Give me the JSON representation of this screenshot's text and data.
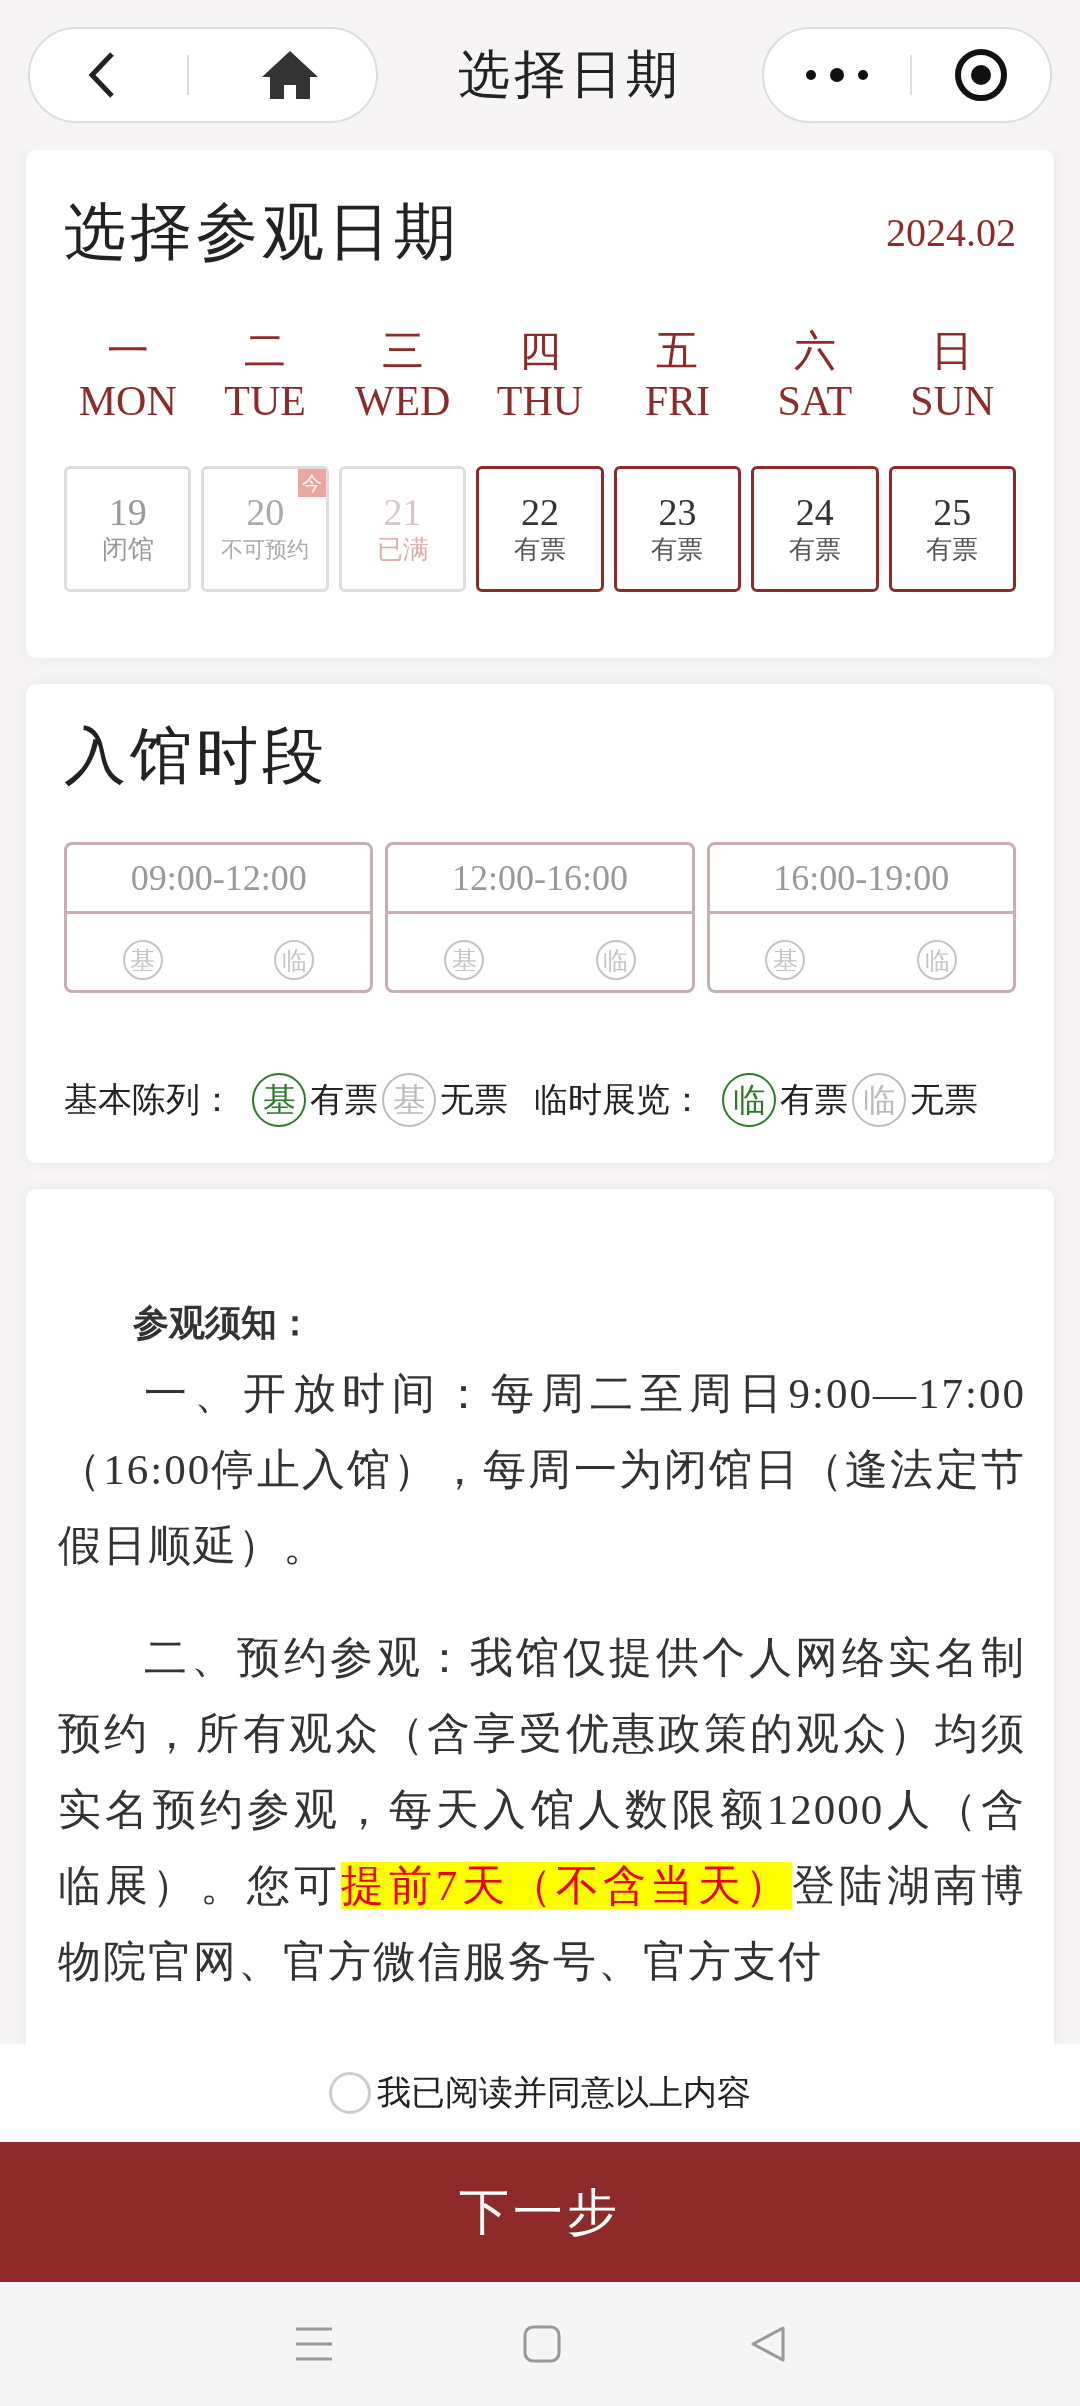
{
  "nav": {
    "title": "选择日期"
  },
  "calendar": {
    "title": "选择参观日期",
    "month": "2024.02",
    "weekdays": [
      {
        "cn": "一",
        "en": "MON"
      },
      {
        "cn": "二",
        "en": "TUE"
      },
      {
        "cn": "三",
        "en": "WED"
      },
      {
        "cn": "四",
        "en": "THU"
      },
      {
        "cn": "五",
        "en": "FRI"
      },
      {
        "cn": "六",
        "en": "SAT"
      },
      {
        "cn": "日",
        "en": "SUN"
      }
    ],
    "days": [
      {
        "day": "19",
        "status": "闭馆",
        "kind": "closed",
        "today": false
      },
      {
        "day": "20",
        "status": "不可预约",
        "kind": "unavailable",
        "today": true,
        "today_label": "今"
      },
      {
        "day": "21",
        "status": "已满",
        "kind": "full",
        "today": false
      },
      {
        "day": "22",
        "status": "有票",
        "kind": "available",
        "today": false
      },
      {
        "day": "23",
        "status": "有票",
        "kind": "available",
        "today": false
      },
      {
        "day": "24",
        "status": "有票",
        "kind": "available",
        "today": false
      },
      {
        "day": "25",
        "status": "有票",
        "kind": "available",
        "today": false
      }
    ]
  },
  "slots": {
    "title": "入馆时段",
    "items": [
      {
        "time": "09:00-12:00",
        "badges": [
          {
            "label": "基",
            "available": false
          },
          {
            "label": "临",
            "available": false
          }
        ]
      },
      {
        "time": "12:00-16:00",
        "badges": [
          {
            "label": "基",
            "available": false
          },
          {
            "label": "临",
            "available": false
          }
        ]
      },
      {
        "time": "16:00-19:00",
        "badges": [
          {
            "label": "基",
            "available": false
          },
          {
            "label": "临",
            "available": false
          }
        ]
      }
    ],
    "legend": [
      {
        "kind": "label",
        "text": "基本陈列："
      },
      {
        "kind": "badge",
        "label": "基",
        "available": true
      },
      {
        "kind": "text",
        "text": "有票"
      },
      {
        "kind": "badge",
        "label": "基",
        "available": false
      },
      {
        "kind": "text",
        "text": "无票"
      },
      {
        "kind": "label",
        "text": "临时展览："
      },
      {
        "kind": "badge",
        "label": "临",
        "available": true
      },
      {
        "kind": "text",
        "text": "有票"
      },
      {
        "kind": "badge",
        "label": "临",
        "available": false
      },
      {
        "kind": "text",
        "text": "无票"
      }
    ]
  },
  "notice": {
    "title": "参观须知：",
    "paragraphs": [
      [
        {
          "text": "一、开放时间：每周二至周日9:00—17:00（16:00停止入馆），每周一为闭馆日（逢法定节假日顺延）。",
          "highlight": false
        }
      ],
      [
        {
          "text": "二、预约参观：我馆仅提供个人网络实名制预约，所有观众（含享受优惠政策的观众）均须实名预约参观，每天入馆人数限额12000人（含临展）。您可",
          "highlight": false
        },
        {
          "text": "提前7天（不含当天）",
          "highlight": true
        },
        {
          "text": "登陆湖南博物院官网、官方微信服务号、官方支付",
          "highlight": false
        }
      ]
    ]
  },
  "agree": {
    "label": "我已阅读并同意以上内容",
    "checked": false
  },
  "next_button": "下一步"
}
